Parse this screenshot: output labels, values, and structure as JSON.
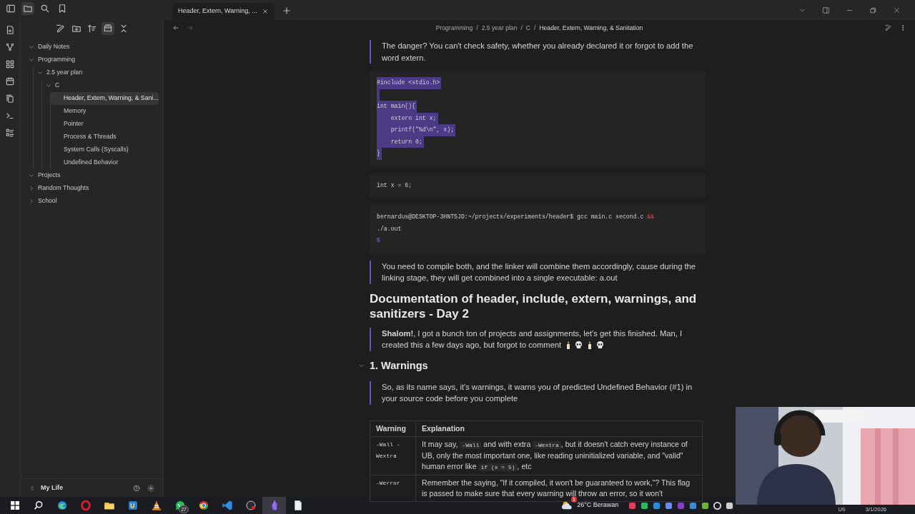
{
  "titlebar": {
    "left_icons": [
      {
        "kind": "sidebar-toggle",
        "selected": false
      },
      {
        "kind": "folder",
        "selected": true
      },
      {
        "kind": "search",
        "selected": false
      },
      {
        "kind": "bookmark",
        "selected": false
      }
    ],
    "tab": {
      "title": "Header, Extern, Warning, ...",
      "selected": true
    },
    "window_icons": [
      {
        "kind": "chevron-down"
      },
      {
        "kind": "sidebar-right"
      },
      {
        "kind": "minimize"
      },
      {
        "kind": "restore"
      },
      {
        "kind": "close"
      }
    ]
  },
  "ribbon": [
    {
      "kind": "file"
    },
    {
      "kind": "graph"
    },
    {
      "kind": "grid"
    },
    {
      "kind": "calendar"
    },
    {
      "kind": "copy"
    },
    {
      "kind": "terminal"
    },
    {
      "kind": "list"
    }
  ],
  "sidebar": {
    "toolbar": [
      {
        "kind": "pencil",
        "selected": false
      },
      {
        "kind": "folder-plus",
        "selected": false
      },
      {
        "kind": "sort",
        "selected": false
      },
      {
        "kind": "card",
        "selected": true
      },
      {
        "kind": "collapse",
        "selected": false
      }
    ],
    "tree": [
      {
        "label": "Daily Notes",
        "expanded": true,
        "selected": false
      },
      {
        "label": "Programming",
        "expanded": true,
        "selected": false,
        "children": [
          {
            "label": "2.5 year plan",
            "expanded": true,
            "selected": false,
            "children": [
              {
                "label": "C",
                "expanded": true,
                "selected": false,
                "children": [
                  {
                    "label": "Header, Extern, Warning, & Sani...",
                    "selected": true
                  },
                  {
                    "label": "Memory",
                    "selected": false
                  },
                  {
                    "label": "Pointer",
                    "selected": false
                  },
                  {
                    "label": "Process & Threads",
                    "selected": false
                  },
                  {
                    "label": "System Calls (Syscalls)",
                    "selected": false
                  },
                  {
                    "label": "Undefined Behavior",
                    "selected": false
                  }
                ]
              }
            ]
          }
        ]
      },
      {
        "label": "Projects",
        "expanded": true,
        "selected": false
      },
      {
        "label": "Random Thoughts",
        "expanded": false,
        "selected": false
      },
      {
        "label": "School",
        "expanded": false,
        "selected": false
      }
    ],
    "vault": "My Life"
  },
  "breadcrumb": {
    "separator": "/",
    "items": [
      "Programming",
      "2.5 year plan",
      "C",
      "Header, Extern, Warning, & Sanitation"
    ]
  },
  "content": [
    {
      "kind": "quote",
      "text": "The danger? You can't check safety, whether you already declared it or forgot to add the word extern."
    },
    {
      "kind": "code",
      "selected": true,
      "text": "#include <stdio.h>\n\nint main(){\n    extern int x;\n    printf(\"%d\\n\", x);\n    return 0;\n}"
    },
    {
      "kind": "code",
      "selected": false,
      "text": "int x = 6;"
    },
    {
      "kind": "terminal",
      "command": "bernardus@DESKTOP-3HNT5JD:~/projects/experiments/header$ gcc main.c second.c",
      "operator": "&&",
      "continuation": "./a.out",
      "output": "6"
    },
    {
      "kind": "quote",
      "text": "You need to compile both, and the linker will combine them accordingly, cause during the linking stage, they will get combined into a single executable: a.out"
    },
    {
      "kind": "h2",
      "text": "Documentation of header, include, extern, warnings, and sanitizers - Day 2"
    },
    {
      "kind": "quote",
      "text": "**Shalom!**, I got a bunch ton of projects and assignments, let's get this finished. Man, I created this a few days ago, but forgot to comment",
      "emoji": [
        {
          "kind": "candle"
        },
        {
          "kind": "skull"
        },
        {
          "kind": "candle"
        },
        {
          "kind": "skull"
        }
      ]
    },
    {
      "kind": "h3",
      "text": "1. Warnings",
      "expanded": true
    },
    {
      "kind": "quote",
      "text": "So, as its name says, it's warnings, it warns you of predicted Undefined Behavior (#1) in your source code before you complete"
    },
    {
      "kind": "table",
      "columns": [
        "Warning",
        "Explanation"
      ],
      "rows": [
        {
          "warning": "-Wall -Wextra",
          "explanation": [
            {
              "kind": "text",
              "text": "It may say, "
            },
            {
              "kind": "code",
              "text": "-Wall"
            },
            {
              "kind": "text",
              "text": " and with extra "
            },
            {
              "kind": "code",
              "text": "-Wextra"
            },
            {
              "kind": "text",
              "text": ", but it doesn't catch every instance of UB, only the most important one, like reading uninitialized variable, and \"valid\" human error like "
            },
            {
              "kind": "code",
              "text": "if (x = 5)"
            },
            {
              "kind": "text",
              "text": ", etc"
            }
          ]
        },
        {
          "warning": "-Werror",
          "explanation": [
            {
              "kind": "text",
              "text": "Remember the saying,  \"If it compiled, it won't be guaranteed to work,\"? This flag is passed to make sure that every warning will throw an error, so it won't"
            }
          ]
        }
      ]
    }
  ],
  "taskbar": {
    "apps": [
      {
        "kind": "start",
        "selected": false
      },
      {
        "kind": "search",
        "selected": false
      },
      {
        "kind": "swirl",
        "selected": false
      },
      {
        "kind": "ring",
        "selected": false
      },
      {
        "kind": "folder",
        "selected": false
      },
      {
        "kind": "tile",
        "selected": false
      },
      {
        "kind": "cone",
        "selected": false
      },
      {
        "kind": "chat",
        "selected": false,
        "badge": "27"
      },
      {
        "kind": "ball",
        "selected": false
      },
      {
        "kind": "ribbon",
        "selected": false
      },
      {
        "kind": "gauge",
        "selected": false
      },
      {
        "kind": "crystal",
        "selected": true
      },
      {
        "kind": "document",
        "selected": false
      }
    ],
    "weather_badge": "1",
    "weather": "26°C  Berawan",
    "tray": [
      {
        "kind": "wheel"
      },
      {
        "kind": "chat"
      },
      {
        "kind": "square"
      },
      {
        "kind": "arrows"
      },
      {
        "kind": "notebook"
      },
      {
        "kind": "cloud"
      },
      {
        "kind": "chip"
      },
      {
        "kind": "ring"
      },
      {
        "kind": "app"
      }
    ],
    "language": "US",
    "date": "3/1/2026"
  }
}
